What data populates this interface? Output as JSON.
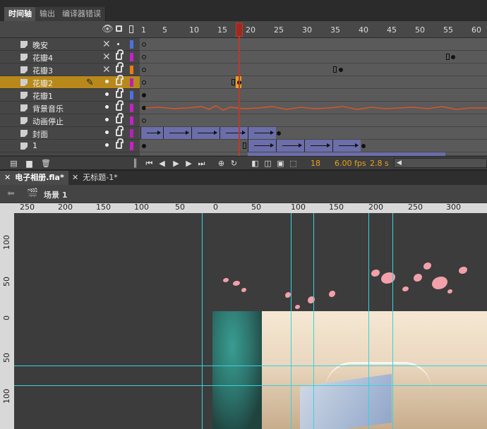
{
  "panel_tabs": [
    "时间轴",
    "输出",
    "编译器错误"
  ],
  "frame_numbers": [
    "1",
    "5",
    "10",
    "15",
    "20",
    "25",
    "30",
    "35",
    "40",
    "45",
    "50",
    "55",
    "60"
  ],
  "layers": [
    {
      "name": "晚安",
      "color": "#4f6fe0"
    },
    {
      "name": "花瓣4",
      "color": "#c820c8"
    },
    {
      "name": "花瓣3",
      "color": "#ee7d10"
    },
    {
      "name": "花瓣2",
      "color": "#b820b8"
    },
    {
      "name": "花瓣1",
      "color": "#4f6fe0"
    },
    {
      "name": "背景音乐",
      "color": "#c820c8"
    },
    {
      "name": "动画停止",
      "color": "#c820c8"
    },
    {
      "name": "封面",
      "color": "#b820b8"
    },
    {
      "name": "1",
      "color": "#c820c8"
    }
  ],
  "footer": {
    "current_frame": "18",
    "fps": "6.00 fps",
    "time": "2.8 s"
  },
  "doc_tabs": [
    "电子相册.fla*",
    "无标题-1*"
  ],
  "scene": "场景 1",
  "h_ruler": [
    "250",
    "200",
    "150",
    "100",
    "50",
    "0",
    "50",
    "100",
    "150",
    "200",
    "250",
    "300"
  ],
  "v_ruler": [
    "100",
    "50",
    "0",
    "50",
    "100"
  ],
  "colors": {
    "accent": "#e8a317",
    "selected_layer": "#b8891a",
    "guide": "#35d3df",
    "playhead": "#c0392b"
  }
}
